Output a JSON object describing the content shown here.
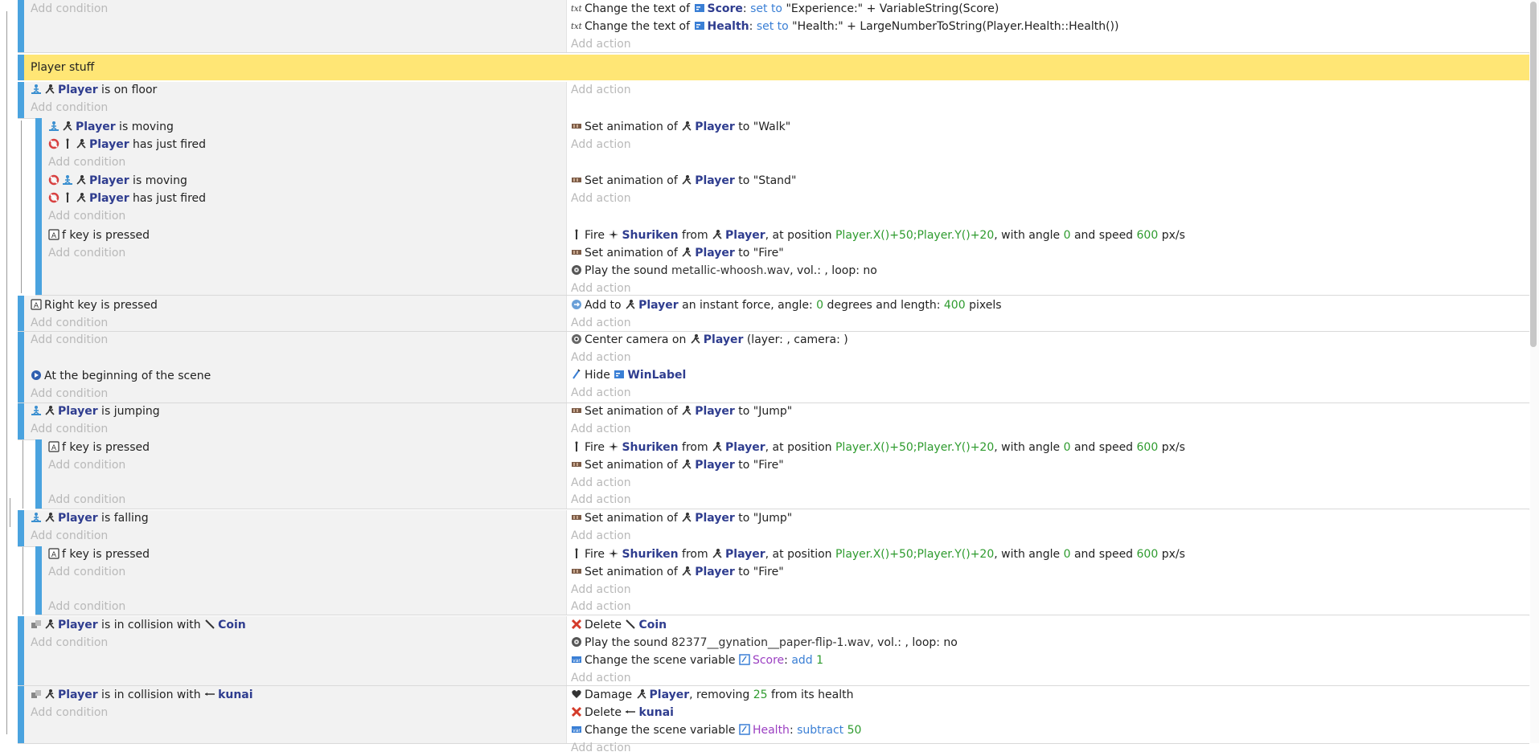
{
  "colors": {
    "event_bar": "#4aa3df",
    "group_band": "#ffe675",
    "object_text": "#2f3d8f",
    "argument_text": "#2e9b2e",
    "operator_text": "#3a7fd5",
    "variable_text": "#9b3fc2",
    "placeholder_text": "#b9b9b9"
  },
  "placeholders": {
    "add_condition": "Add condition",
    "add_action": "Add action"
  },
  "group": {
    "title": "Player stuff"
  },
  "events": [
    {
      "id": "e0",
      "conditions": [],
      "actions": [
        [
          {
            "icon": "text-icon"
          },
          {
            "t": "Change the text of "
          },
          {
            "icon": "label-icon"
          },
          {
            "t": "Score",
            "c": "obj"
          },
          {
            "t": ": "
          },
          {
            "t": "set to",
            "c": "op"
          },
          {
            "t": " \"Experience:\" + VariableString(Score)"
          }
        ],
        [
          {
            "icon": "text-icon"
          },
          {
            "t": "Change the text of "
          },
          {
            "icon": "label-icon"
          },
          {
            "t": "Health",
            "c": "obj"
          },
          {
            "t": ": "
          },
          {
            "t": "set to",
            "c": "op"
          },
          {
            "t": " \"Health:\" + LargeNumberToString(Player.Health::Health())"
          }
        ]
      ]
    },
    {
      "id": "e1",
      "conditions": [
        [
          {
            "icon": "platformer-icon"
          },
          {
            "icon": "player-icon"
          },
          {
            "t": "Player",
            "c": "obj"
          },
          {
            "t": " is on floor"
          }
        ]
      ],
      "actions": []
    },
    {
      "id": "e2",
      "conditions": [
        [
          {
            "icon": "platformer-icon"
          },
          {
            "icon": "player-icon"
          },
          {
            "t": "Player",
            "c": "obj"
          },
          {
            "t": " is moving"
          }
        ],
        [
          {
            "icon": "invert-icon"
          },
          {
            "icon": "fire-icon"
          },
          {
            "icon": "player-icon"
          },
          {
            "t": "Player",
            "c": "obj"
          },
          {
            "t": " has just fired"
          }
        ]
      ],
      "actions": [
        [
          {
            "icon": "animation-icon"
          },
          {
            "t": "Set animation of "
          },
          {
            "icon": "player-icon"
          },
          {
            "t": "Player",
            "c": "obj"
          },
          {
            "t": " to \"Walk\""
          }
        ]
      ]
    },
    {
      "id": "e3",
      "conditions": [
        [
          {
            "icon": "invert-icon"
          },
          {
            "icon": "platformer-icon"
          },
          {
            "icon": "player-icon"
          },
          {
            "t": "Player",
            "c": "obj"
          },
          {
            "t": " is moving"
          }
        ],
        [
          {
            "icon": "invert-icon"
          },
          {
            "icon": "fire-icon"
          },
          {
            "icon": "player-icon"
          },
          {
            "t": "Player",
            "c": "obj"
          },
          {
            "t": " has just fired"
          }
        ]
      ],
      "actions": [
        [
          {
            "icon": "animation-icon"
          },
          {
            "t": "Set animation of "
          },
          {
            "icon": "player-icon"
          },
          {
            "t": "Player",
            "c": "obj"
          },
          {
            "t": " to \"Stand\""
          }
        ]
      ]
    },
    {
      "id": "e4",
      "conditions": [
        [
          {
            "icon": "keyboard-icon"
          },
          {
            "t": "f key is pressed"
          }
        ]
      ],
      "actions": [
        [
          {
            "icon": "fire-icon"
          },
          {
            "t": "Fire "
          },
          {
            "icon": "shuriken-icon"
          },
          {
            "t": "Shuriken",
            "c": "obj"
          },
          {
            "t": " from "
          },
          {
            "icon": "player-icon"
          },
          {
            "t": "Player",
            "c": "obj"
          },
          {
            "t": ", at position "
          },
          {
            "t": "Player.X()+50;Player.Y()+20",
            "c": "arg"
          },
          {
            "t": ", with angle "
          },
          {
            "t": "0",
            "c": "arg"
          },
          {
            "t": " and speed "
          },
          {
            "t": "600",
            "c": "arg"
          },
          {
            "t": " px/s"
          }
        ],
        [
          {
            "icon": "animation-icon"
          },
          {
            "t": "Set animation of "
          },
          {
            "icon": "player-icon"
          },
          {
            "t": "Player",
            "c": "obj"
          },
          {
            "t": " to \"Fire\""
          }
        ],
        [
          {
            "icon": "sound-icon"
          },
          {
            "t": "Play the sound "
          },
          {
            "t": "metallic-whoosh.wav",
            "c": "text"
          },
          {
            "t": ", vol.: , loop: no"
          }
        ]
      ]
    },
    {
      "id": "e5",
      "conditions": [
        [
          {
            "icon": "keyboard-icon"
          },
          {
            "t": "Right key is pressed"
          }
        ]
      ],
      "actions": [
        [
          {
            "icon": "force-icon"
          },
          {
            "t": "Add to "
          },
          {
            "icon": "player-icon"
          },
          {
            "t": "Player",
            "c": "obj"
          },
          {
            "t": " an instant force, angle: "
          },
          {
            "t": "0",
            "c": "arg"
          },
          {
            "t": " degrees and length: "
          },
          {
            "t": "400",
            "c": "arg"
          },
          {
            "t": " pixels"
          }
        ]
      ]
    },
    {
      "id": "e6",
      "conditions": [],
      "actions": [
        [
          {
            "icon": "camera-icon"
          },
          {
            "t": "Center camera on "
          },
          {
            "icon": "player-icon"
          },
          {
            "t": "Player",
            "c": "obj"
          },
          {
            "t": " (layer: , camera: )"
          }
        ]
      ]
    },
    {
      "id": "e7",
      "conditions": [
        [
          {
            "icon": "scene-start-icon"
          },
          {
            "t": "At the beginning of the scene"
          }
        ]
      ],
      "actions": [
        [
          {
            "icon": "visibility-icon"
          },
          {
            "t": "Hide "
          },
          {
            "icon": "label-icon"
          },
          {
            "t": "WinLabel",
            "c": "obj"
          }
        ]
      ]
    },
    {
      "id": "e8",
      "conditions": [
        [
          {
            "icon": "platformer-icon"
          },
          {
            "icon": "player-icon"
          },
          {
            "t": "Player",
            "c": "obj"
          },
          {
            "t": " is jumping"
          }
        ]
      ],
      "actions": [
        [
          {
            "icon": "animation-icon"
          },
          {
            "t": "Set animation of "
          },
          {
            "icon": "player-icon"
          },
          {
            "t": "Player",
            "c": "obj"
          },
          {
            "t": " to \"Jump\""
          }
        ]
      ]
    },
    {
      "id": "e9",
      "conditions": [
        [
          {
            "icon": "keyboard-icon"
          },
          {
            "t": "f key is pressed"
          }
        ]
      ],
      "actions": [
        [
          {
            "icon": "fire-icon"
          },
          {
            "t": "Fire "
          },
          {
            "icon": "shuriken-icon"
          },
          {
            "t": "Shuriken",
            "c": "obj"
          },
          {
            "t": " from "
          },
          {
            "icon": "player-icon"
          },
          {
            "t": "Player",
            "c": "obj"
          },
          {
            "t": ", at position "
          },
          {
            "t": "Player.X()+50;Player.Y()+20",
            "c": "arg"
          },
          {
            "t": ", with angle "
          },
          {
            "t": "0",
            "c": "arg"
          },
          {
            "t": " and speed "
          },
          {
            "t": "600",
            "c": "arg"
          },
          {
            "t": " px/s"
          }
        ],
        [
          {
            "icon": "animation-icon"
          },
          {
            "t": "Set animation of "
          },
          {
            "icon": "player-icon"
          },
          {
            "t": "Player",
            "c": "obj"
          },
          {
            "t": " to \"Fire\""
          }
        ]
      ]
    },
    {
      "id": "e10",
      "conditions": [],
      "actions": []
    },
    {
      "id": "e11",
      "conditions": [
        [
          {
            "icon": "platformer-icon"
          },
          {
            "icon": "player-icon"
          },
          {
            "t": "Player",
            "c": "obj"
          },
          {
            "t": " is falling"
          }
        ]
      ],
      "actions": [
        [
          {
            "icon": "animation-icon"
          },
          {
            "t": "Set animation of "
          },
          {
            "icon": "player-icon"
          },
          {
            "t": "Player",
            "c": "obj"
          },
          {
            "t": " to \"Jump\""
          }
        ]
      ]
    },
    {
      "id": "e12",
      "conditions": [
        [
          {
            "icon": "keyboard-icon"
          },
          {
            "t": "f key is pressed"
          }
        ]
      ],
      "actions": [
        [
          {
            "icon": "fire-icon"
          },
          {
            "t": "Fire "
          },
          {
            "icon": "shuriken-icon"
          },
          {
            "t": "Shuriken",
            "c": "obj"
          },
          {
            "t": " from "
          },
          {
            "icon": "player-icon"
          },
          {
            "t": "Player",
            "c": "obj"
          },
          {
            "t": ", at position "
          },
          {
            "t": "Player.X()+50;Player.Y()+20",
            "c": "arg"
          },
          {
            "t": ", with angle "
          },
          {
            "t": "0",
            "c": "arg"
          },
          {
            "t": " and speed "
          },
          {
            "t": "600",
            "c": "arg"
          },
          {
            "t": " px/s"
          }
        ],
        [
          {
            "icon": "animation-icon"
          },
          {
            "t": "Set animation of "
          },
          {
            "icon": "player-icon"
          },
          {
            "t": "Player",
            "c": "obj"
          },
          {
            "t": " to \"Fire\""
          }
        ]
      ]
    },
    {
      "id": "e13",
      "conditions": [],
      "actions": []
    },
    {
      "id": "e14",
      "conditions": [
        [
          {
            "icon": "collision-icon"
          },
          {
            "icon": "player-icon"
          },
          {
            "t": "Player",
            "c": "obj"
          },
          {
            "t": " is in collision with "
          },
          {
            "icon": "coin-icon"
          },
          {
            "t": "Coin",
            "c": "obj"
          }
        ]
      ],
      "actions": [
        [
          {
            "icon": "delete-icon"
          },
          {
            "t": "Delete "
          },
          {
            "icon": "coin-icon"
          },
          {
            "t": "Coin",
            "c": "obj"
          }
        ],
        [
          {
            "icon": "sound-icon"
          },
          {
            "t": "Play the sound "
          },
          {
            "t": "82377__gynation__paper-flip-1.wav",
            "c": "text"
          },
          {
            "t": ", vol.: , loop: no"
          }
        ],
        [
          {
            "icon": "variable-icon"
          },
          {
            "t": "Change the scene variable "
          },
          {
            "icon": "var-icon"
          },
          {
            "t": "Score",
            "c": "var"
          },
          {
            "t": ": "
          },
          {
            "t": "add",
            "c": "op"
          },
          {
            "t": " "
          },
          {
            "t": "1",
            "c": "arg"
          }
        ]
      ]
    },
    {
      "id": "e15",
      "conditions": [
        [
          {
            "icon": "collision-icon"
          },
          {
            "icon": "player-icon"
          },
          {
            "t": "Player",
            "c": "obj"
          },
          {
            "t": " is in collision with "
          },
          {
            "icon": "kunai-icon"
          },
          {
            "t": "kunai",
            "c": "obj"
          }
        ]
      ],
      "actions": [
        [
          {
            "icon": "health-icon"
          },
          {
            "t": "Damage "
          },
          {
            "icon": "player-icon"
          },
          {
            "t": "Player",
            "c": "obj"
          },
          {
            "t": ", removing "
          },
          {
            "t": "25",
            "c": "arg"
          },
          {
            "t": " from its health"
          }
        ],
        [
          {
            "icon": "delete-icon"
          },
          {
            "t": "Delete "
          },
          {
            "icon": "kunai-icon"
          },
          {
            "t": "kunai",
            "c": "obj"
          }
        ],
        [
          {
            "icon": "variable-icon"
          },
          {
            "t": "Change the scene variable "
          },
          {
            "icon": "var-icon"
          },
          {
            "t": "Health",
            "c": "var"
          },
          {
            "t": ": "
          },
          {
            "t": "subtract",
            "c": "op"
          },
          {
            "t": " "
          },
          {
            "t": "50",
            "c": "arg"
          }
        ]
      ]
    }
  ]
}
